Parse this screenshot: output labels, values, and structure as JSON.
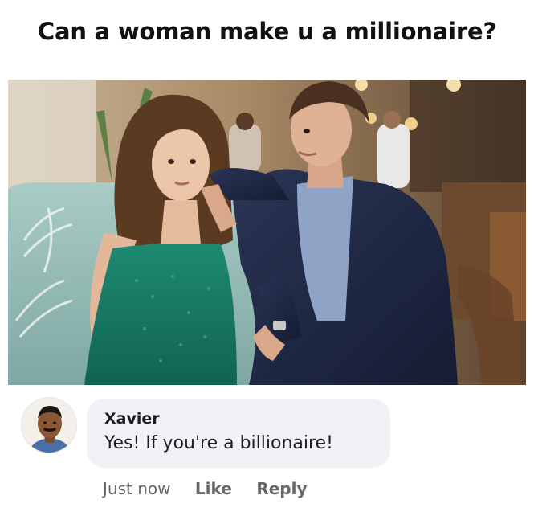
{
  "meme": {
    "title": "Can a woman make u a millionaire?"
  },
  "photo": {
    "description_icon": "couple-photo"
  },
  "comment": {
    "author": "Xavier",
    "text": "Yes! If you're a billionaire!",
    "timestamp": "Just now",
    "like_label": "Like",
    "reply_label": "Reply",
    "avatar_icon": "avatar-photo"
  },
  "colors": {
    "bubble": "#f0f2f5",
    "meta_text": "#65676b",
    "title_text": "#111111"
  }
}
